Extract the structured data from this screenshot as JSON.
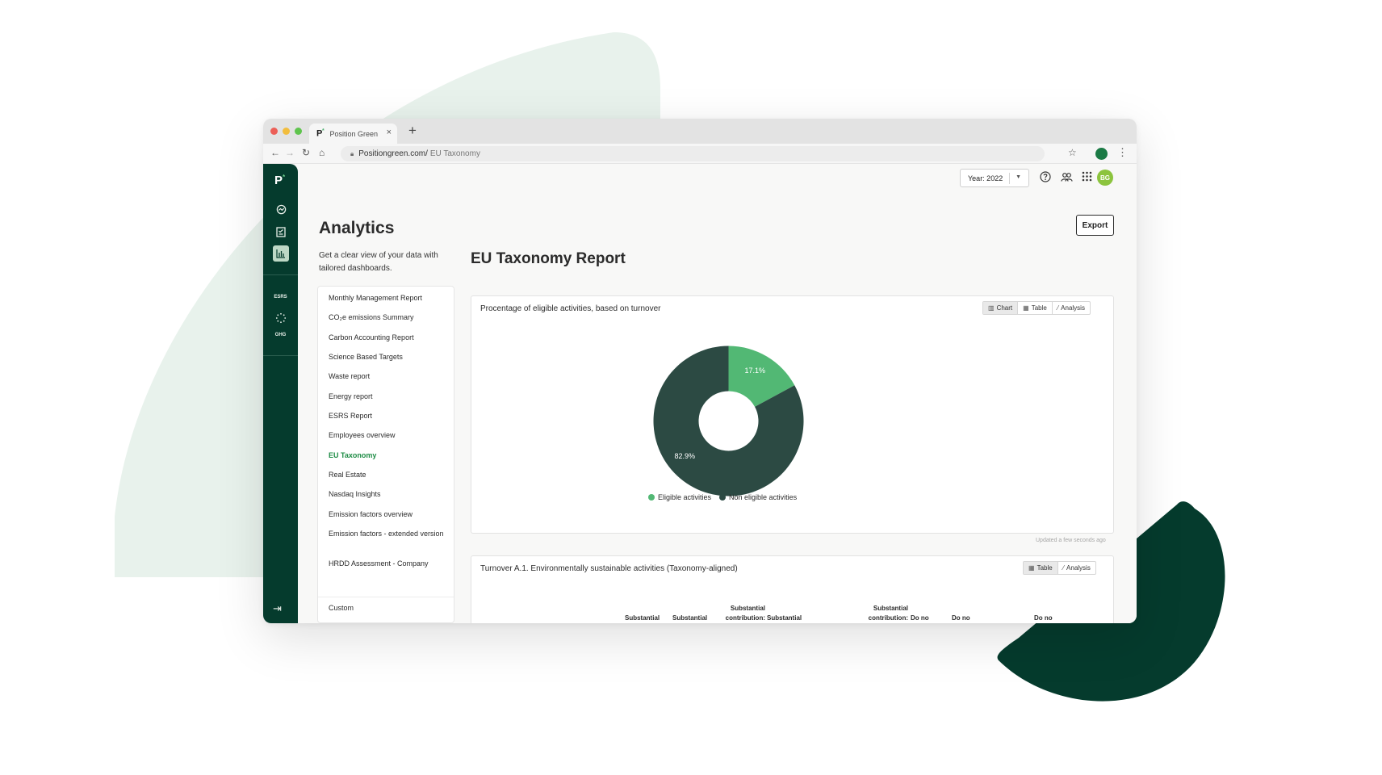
{
  "browser": {
    "tab_logo": "P",
    "tab_logo_mark": "*",
    "tab_title": "Position Green",
    "tab_close": "×",
    "new_tab": "+",
    "url_host": "Positiongreen.com/",
    "url_path": "EU Taxonomy"
  },
  "header": {
    "year_label": "Year: 2022",
    "avatar_initials": "BG"
  },
  "rail": {
    "logo": "P",
    "logo_mark": "*",
    "esrs": "ESRS",
    "ghg": "GHG"
  },
  "sidebar": {
    "title": "Analytics",
    "subtitle": "Get a clear view of your data with tailored dashboards.",
    "items": [
      {
        "label": "Monthly Management Report"
      },
      {
        "label": "CO₂e emissions Summary"
      },
      {
        "label": "Carbon Accounting Report"
      },
      {
        "label": "Science Based Targets"
      },
      {
        "label": "Waste report"
      },
      {
        "label": "Energy report"
      },
      {
        "label": "ESRS Report"
      },
      {
        "label": "Employees overview"
      },
      {
        "label": "EU Taxonomy",
        "active": true
      },
      {
        "label": "Real Estate"
      },
      {
        "label": "Nasdaq Insights"
      },
      {
        "label": "Emission factors overview"
      },
      {
        "label": "Emission factors - extended version"
      },
      {
        "label": "HRDD Assessment - Company"
      },
      {
        "label": "Custom"
      }
    ]
  },
  "main": {
    "export_label": "Export",
    "report_title": "EU Taxonomy Report",
    "card1": {
      "title": "Procentage of eligible activities, based on turnover",
      "btn_chart": "Chart",
      "btn_table": "Table",
      "btn_analysis": "Analysis",
      "updated": "Updated a few seconds ago"
    },
    "card2": {
      "title": "Turnover A.1. Environmentally sustainable activities (Taxonomy-aligned)",
      "btn_table": "Table",
      "btn_analysis": "Analysis",
      "col_substantial_1": "Substantial",
      "col_substantial_2": "Substantial",
      "col_substantial_contribution_1": "Substantial contribution:",
      "col_substantial_3": "Substantial",
      "col_substantial_contribution_2": "Substantial contribution:",
      "col_do_no_1": "Do no",
      "col_do_no_2": "Do no",
      "col_do_no_3": "Do no"
    }
  },
  "colors": {
    "rail": "#053b2d",
    "eligible": "#52b874",
    "non_eligible": "#2c4a43",
    "active_item": "#1e8c45"
  },
  "chart_data": {
    "type": "pie",
    "title": "Procentage of eligible activities, based on turnover",
    "donut": true,
    "categories": [
      "Eligible activities",
      "Non eligible activities"
    ],
    "values": [
      17.1,
      82.9
    ],
    "value_labels": [
      "17.1%",
      "82.9%"
    ],
    "legend_position": "bottom"
  }
}
